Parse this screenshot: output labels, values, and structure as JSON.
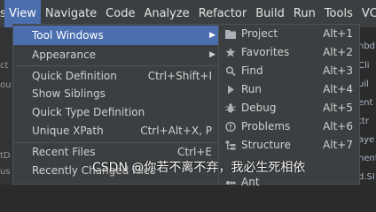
{
  "menubar": {
    "items": [
      {
        "label": "s"
      },
      {
        "label": "View"
      },
      {
        "label": "Navigate"
      },
      {
        "label": "Code"
      },
      {
        "label": "Analyze"
      },
      {
        "label": "Refactor"
      },
      {
        "label": "Build"
      },
      {
        "label": "Run"
      },
      {
        "label": "Tools"
      },
      {
        "label": "VCS"
      }
    ]
  },
  "view_menu": {
    "tool_windows": "Tool Windows",
    "appearance": "Appearance",
    "quick_definition": "Quick Definition",
    "quick_definition_shortcut": "Ctrl+Shift+I",
    "show_siblings": "Show Siblings",
    "quick_type_definition": "Quick Type Definition",
    "unique_xpath": "Unique XPath",
    "unique_xpath_shortcut": "Ctrl+Alt+X, P",
    "recent_files": "Recent Files",
    "recent_files_shortcut": "Ctrl+E",
    "recently_changed": "Recently Changed Files"
  },
  "tool_windows_menu": {
    "items": [
      {
        "label": "Project",
        "shortcut": "Alt+1",
        "icon": "folder-icon"
      },
      {
        "label": "Favorites",
        "shortcut": "Alt+2",
        "icon": "star-icon"
      },
      {
        "label": "Find",
        "shortcut": "Alt+3",
        "icon": "search-icon"
      },
      {
        "label": "Run",
        "shortcut": "Alt+4",
        "icon": "run-icon"
      },
      {
        "label": "Debug",
        "shortcut": "Alt+5",
        "icon": "bug-icon"
      },
      {
        "label": "Problems",
        "shortcut": "Alt+6",
        "icon": "problems-icon"
      },
      {
        "label": "Structure",
        "shortcut": "Alt+7",
        "icon": "structure-icon"
      },
      {
        "label": "Ant",
        "shortcut": "",
        "icon": "ant-icon"
      }
    ]
  },
  "left_edge": [
    "ct",
    "ou",
    "tD",
    "us"
  ],
  "right_edge": [
    "nbd",
    "Cli",
    "uil",
    "ent",
    "ttr",
    "aye",
    "nent",
    "d.SI"
  ],
  "watermark": "CSDN @你若不离不弃，我必生死相依"
}
